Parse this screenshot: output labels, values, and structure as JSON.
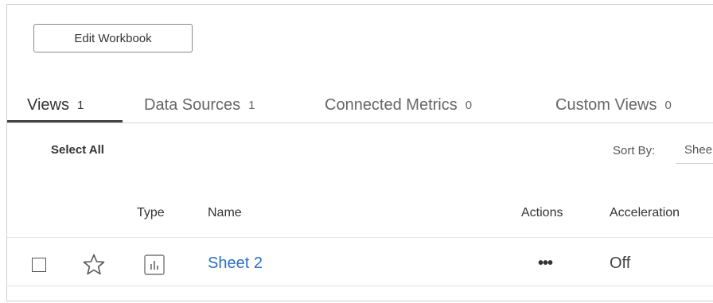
{
  "toolbar": {
    "edit_label": "Edit Workbook"
  },
  "tabs": [
    {
      "label": "Views",
      "count": "1",
      "active": true
    },
    {
      "label": "Data Sources",
      "count": "1",
      "active": false
    },
    {
      "label": "Connected Metrics",
      "count": "0",
      "active": false
    },
    {
      "label": "Custom Views",
      "count": "0",
      "active": false
    }
  ],
  "list_controls": {
    "select_all": "Select All",
    "sort_label": "Sort By:",
    "sort_value": "Shee"
  },
  "table": {
    "headers": {
      "type": "Type",
      "name": "Name",
      "actions": "Actions",
      "acceleration": "Acceleration"
    },
    "rows": [
      {
        "star_icon": "star-outline-icon",
        "type_icon": "sheet-chart-icon",
        "name": "Sheet 2",
        "actions": "•••",
        "acceleration": "Off"
      }
    ]
  },
  "colors": {
    "link": "#2e6fc0",
    "active_tab_underline": "#444444"
  }
}
